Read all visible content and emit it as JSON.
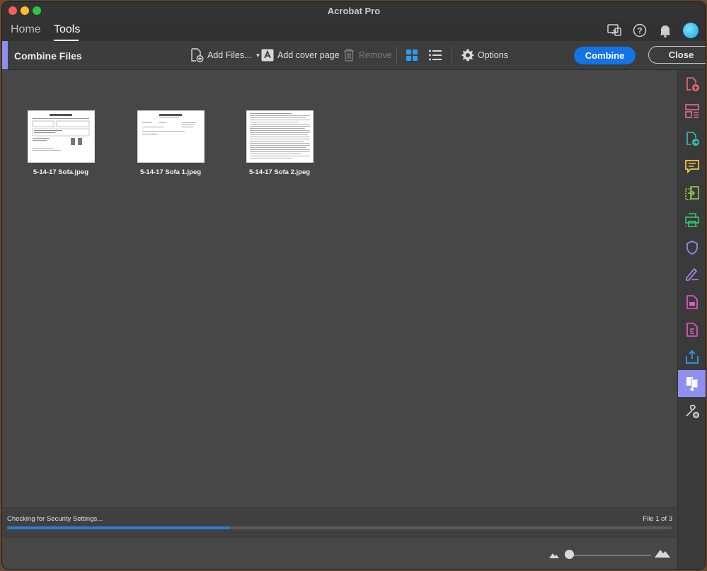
{
  "window": {
    "title": "Acrobat Pro"
  },
  "nav": {
    "home": "Home",
    "tools": "Tools"
  },
  "topicons": [
    "share-screen-icon",
    "help-icon",
    "bell-icon",
    "avatar"
  ],
  "toolbar": {
    "title": "Combine Files",
    "add_files": "Add Files...",
    "add_cover": "Add cover page",
    "remove": "Remove",
    "options": "Options",
    "combine": "Combine",
    "close": "Close"
  },
  "files": [
    {
      "name": "5-14-17 Sofa.jpeg"
    },
    {
      "name": "5-14-17 Sofa 1.jpeg"
    },
    {
      "name": "5-14-17 Sofa 2.jpeg"
    }
  ],
  "status": {
    "text": "Checking for Security Settings...",
    "count": "File 1 of 3",
    "progress": 0.335
  },
  "rightbar_icons": [
    "create-pdf-icon",
    "organize-pages-icon",
    "export-pdf-icon",
    "comment-icon",
    "compare-icon",
    "print-production-icon",
    "protect-icon",
    "fill-sign-icon",
    "pdf-standards-icon",
    "form-icon",
    "share-icon",
    "combine-files-icon",
    "more-tools-icon"
  ],
  "colors": {
    "accent": "#1473e6",
    "active_tool": "#8f8ff2"
  }
}
